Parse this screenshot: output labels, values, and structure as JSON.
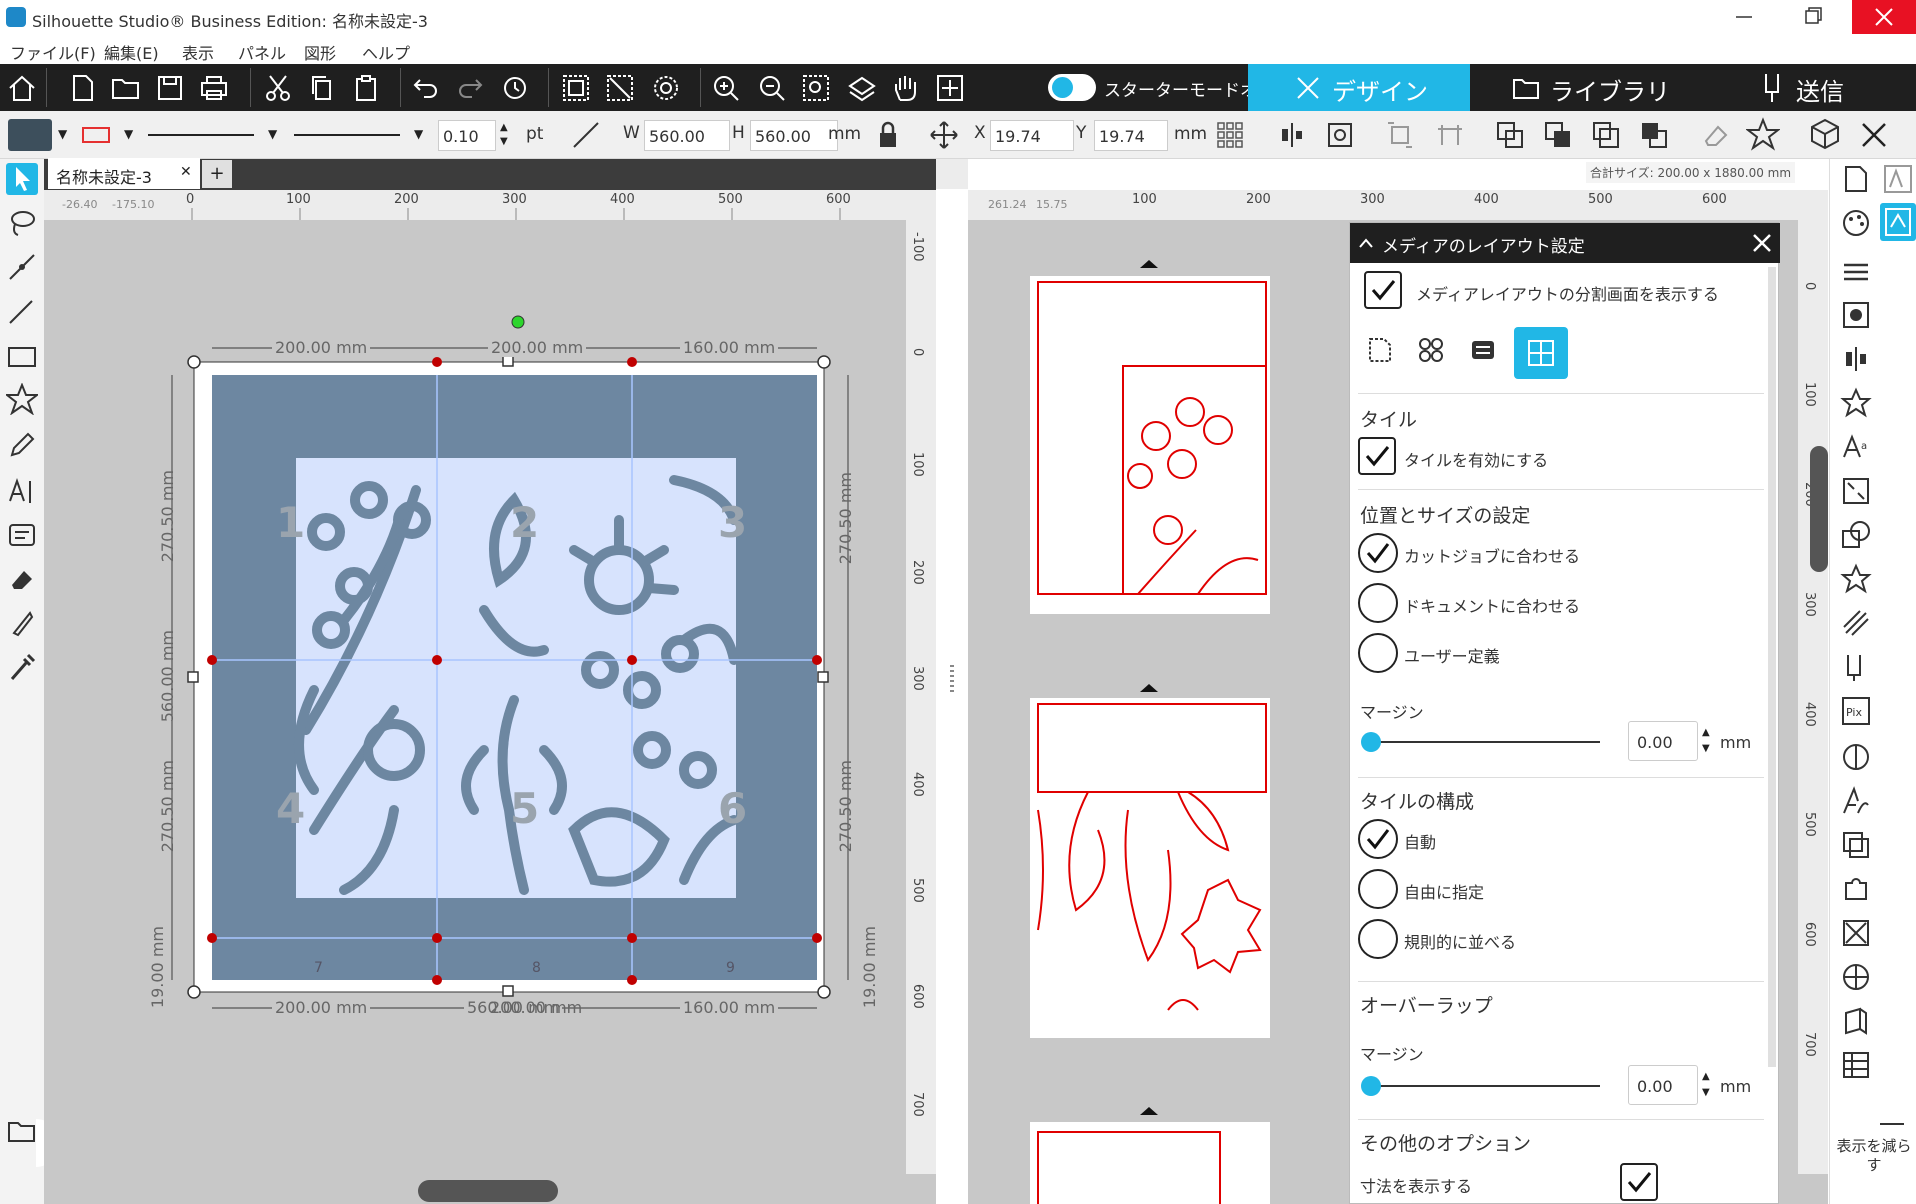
{
  "window": {
    "title": "Silhouette Studio® Business Edition: 名称未設定-3"
  },
  "menu": [
    "ファイル(F)",
    "編集(E)",
    "表示",
    "パネル",
    "図形",
    "ヘルプ"
  ],
  "toolbar": {
    "starter_mode": "スターターモードオフ",
    "tabs": {
      "design": "デザイン",
      "library": "ライブラリ",
      "send": "送信"
    }
  },
  "props": {
    "line_width": "0.10",
    "line_unit": "pt",
    "w_label": "W",
    "w_value": "560.00",
    "h_label": "H",
    "h_value": "560.00",
    "size_unit": "mm",
    "x_label": "X",
    "x_value": "19.74",
    "y_label": "Y",
    "y_value": "19.74",
    "pos_unit": "mm",
    "colors": {
      "fill": "#3d4f5c",
      "stroke": "#e53030",
      "accent": "#21b7e6",
      "design": "#6d87a1",
      "cut": "#e00000"
    }
  },
  "document": {
    "tab_name": "名称未設定-3",
    "add_tab": "+",
    "ruler_readout_x": "-26.40",
    "ruler_readout_y": "-175.10",
    "total_size": "合計サイズ: 200.00 x 1880.00 mm"
  },
  "ruler_left_h": [
    "0",
    "100",
    "200",
    "300",
    "400",
    "500",
    "600"
  ],
  "ruler_left_v": [
    "-100",
    "0",
    "100",
    "200",
    "300",
    "400",
    "500",
    "600",
    "700"
  ],
  "ruler_right_h": [
    "100",
    "200",
    "300",
    "400",
    "500",
    "600"
  ],
  "ruler_right_readout": [
    "261.24",
    "15.75"
  ],
  "ruler_right_v": [
    "0",
    "100",
    "200",
    "300",
    "400",
    "500",
    "600",
    "700"
  ],
  "dimensions": {
    "top": [
      "200.00 mm",
      "200.00 mm",
      "160.00 mm"
    ],
    "bottom": [
      "200.00 mm",
      "560.00 mm",
      "200.00 mm",
      "160.00 mm"
    ],
    "left": [
      "270.50 mm",
      "560.00 mm",
      "270.50 mm",
      "19.00 mm"
    ],
    "right": [
      "270.50 mm",
      "270.50 mm",
      "19.00 mm"
    ]
  },
  "tile_numbers": [
    "1",
    "2",
    "3",
    "4",
    "5",
    "6",
    "7",
    "8",
    "9"
  ],
  "panel": {
    "title": "メディアのレイアウト設定",
    "show_split": "メディアレイアウトの分割画面を表示する",
    "tile_section": "タイル",
    "enable_tile": "タイルを有効にする",
    "pos_size_section": "位置とサイズの設定",
    "fit_cutjob": "カットジョブに合わせる",
    "fit_document": "ドキュメントに合わせる",
    "user_defined": "ユーザー定義",
    "margin_label": "マージン",
    "margin_value": "0.00",
    "margin_unit": "mm",
    "tile_config_section": "タイルの構成",
    "auto": "自動",
    "free": "自由に指定",
    "regular": "規則的に並べる",
    "overlap_section": "オーバーラップ",
    "overlap_margin_label": "マージン",
    "overlap_value": "0.00",
    "overlap_unit": "mm",
    "other_section": "その他のオプション",
    "show_dims": "寸法を表示する"
  },
  "right_sidebar": {
    "reduce_label": "表示を減らす"
  }
}
